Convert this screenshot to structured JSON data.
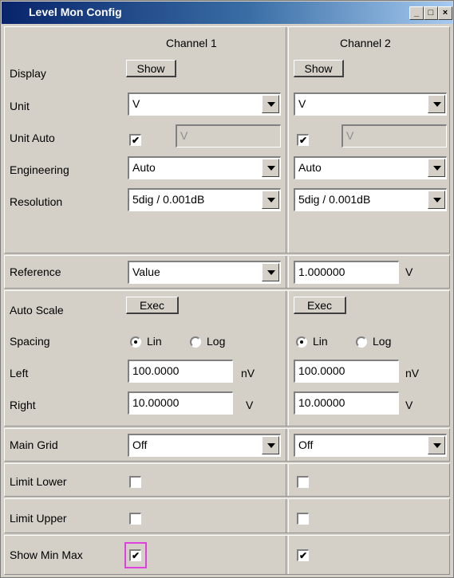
{
  "window": {
    "title": "Level Mon Config",
    "controls": [
      "_",
      "□",
      "×"
    ]
  },
  "columns": {
    "ch1": "Channel 1",
    "ch2": "Channel 2"
  },
  "rows": {
    "display": {
      "label": "Display",
      "ch1": "Show",
      "ch2": "Show"
    },
    "unit": {
      "label": "Unit",
      "ch1": "V",
      "ch2": "V"
    },
    "unit_auto": {
      "label": "Unit Auto",
      "ch1_checked": true,
      "ch1_value": "V",
      "ch2_checked": true,
      "ch2_value": "V"
    },
    "engineering": {
      "label": "Engineering",
      "ch1": "Auto",
      "ch2": "Auto"
    },
    "resolution": {
      "label": "Resolution",
      "ch1": "5dig / 0.001dB",
      "ch2": "5dig / 0.001dB"
    },
    "reference": {
      "label": "Reference",
      "ch1": "Value",
      "ch2_value": "1.000000",
      "ch2_unit": "V"
    },
    "auto_scale": {
      "label": "Auto Scale",
      "ch1": "Exec",
      "ch2": "Exec"
    },
    "spacing": {
      "label": "Spacing",
      "lin": "Lin",
      "log": "Log",
      "ch1": "Lin",
      "ch2": "Lin"
    },
    "left": {
      "label": "Left",
      "ch1_value": "100.0000",
      "ch1_unit": "nV",
      "ch2_value": "100.0000",
      "ch2_unit": "nV"
    },
    "right": {
      "label": "Right",
      "ch1_value": "10.00000",
      "ch1_unit": "V",
      "ch2_value": "10.00000",
      "ch2_unit": "V"
    },
    "main_grid": {
      "label": "Main Grid",
      "ch1": "Off",
      "ch2": "Off"
    },
    "limit_lower": {
      "label": "Limit Lower",
      "ch1_checked": false,
      "ch2_checked": false
    },
    "limit_upper": {
      "label": "Limit Upper",
      "ch1_checked": false,
      "ch2_checked": false
    },
    "show_min_max": {
      "label": "Show Min Max",
      "ch1_checked": true,
      "ch2_checked": true
    }
  },
  "colors": {
    "title_start": "#08246b",
    "title_end": "#a6caf0",
    "panel": "#d4d0c8",
    "focus": "#e040e0"
  }
}
